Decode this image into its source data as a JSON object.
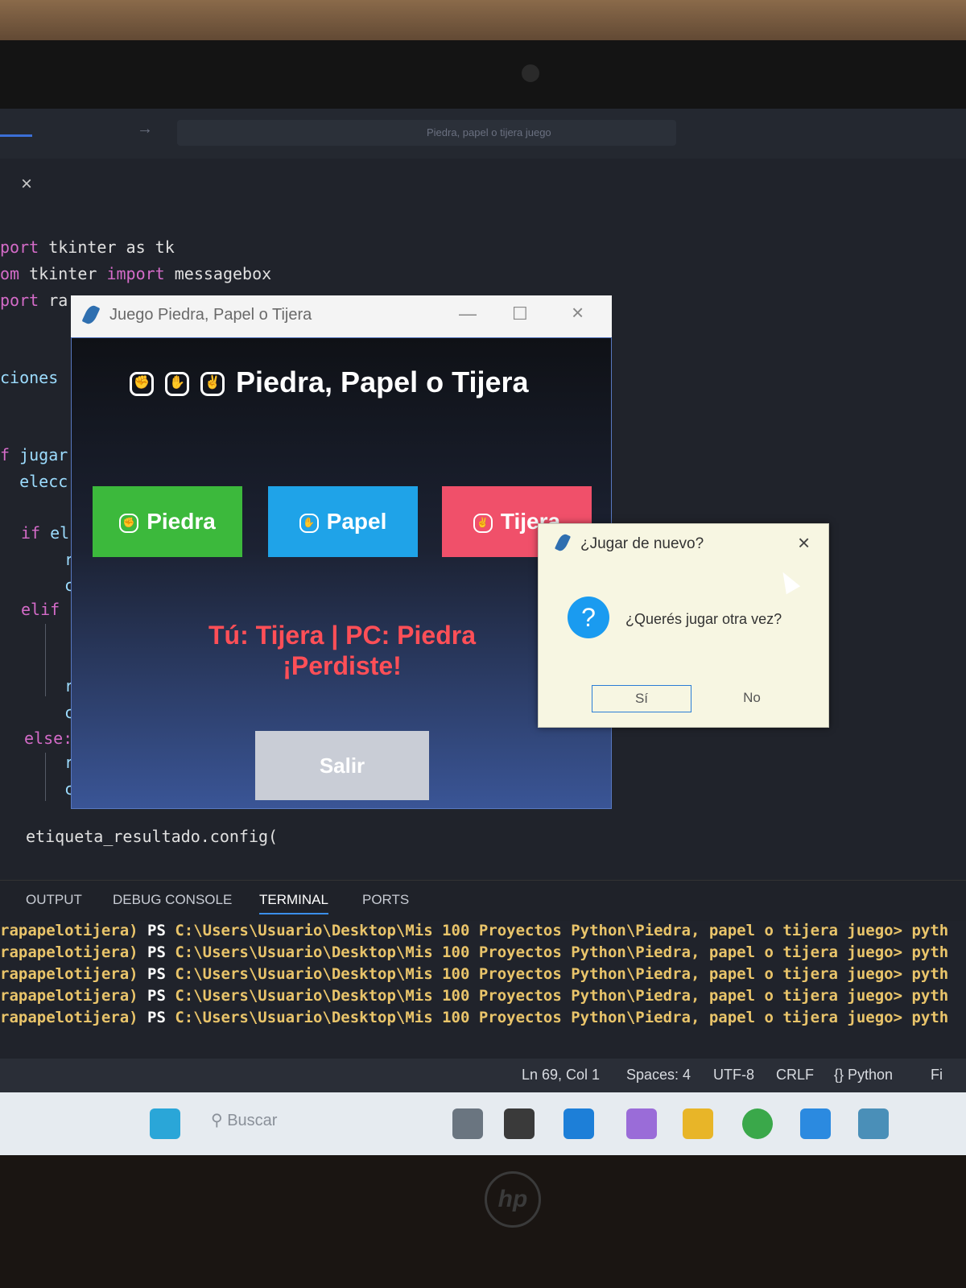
{
  "editor": {
    "search_placeholder": "Piedra, papel o tijera juego",
    "tab_close": "×",
    "code": {
      "l1_kw": "port",
      "l1_rest": " tkinter as tk",
      "l2_kw": "om",
      "l2_mid": " tkinter ",
      "l2_kw2": "import",
      "l2_rest": " messagebox",
      "l3_kw": "port",
      "l3_rest": " ra",
      "l4": "ciones",
      "l5_kw": "f",
      "l5_rest": " jugar",
      "l6": "  elecc",
      "l7_kw": "if",
      "l7_rest": " el",
      "l8": "r",
      "l9": "c",
      "l10_kw": "elif",
      "l11": "r",
      "l12": "c",
      "l13_kw": "else:",
      "l14": "r",
      "l15": "c",
      "l16": "etiqueta_resultado.config("
    }
  },
  "panel": {
    "tabs": [
      "OUTPUT",
      "DEBUG CONSOLE",
      "TERMINAL",
      "PORTS"
    ],
    "active_tab": "TERMINAL",
    "terminal_lines": [
      {
        "env": "rapapelotijera)",
        "ps": " PS ",
        "path": "C:\\Users\\Usuario\\Desktop\\Mis 100 Proyectos Python\\Piedra, papel o tijera juego>",
        "cmd": " pyth"
      },
      {
        "env": "rapapelotijera)",
        "ps": " PS ",
        "path": "C:\\Users\\Usuario\\Desktop\\Mis 100 Proyectos Python\\Piedra, papel o tijera juego>",
        "cmd": " pyth"
      },
      {
        "env": "rapapelotijera)",
        "ps": " PS ",
        "path": "C:\\Users\\Usuario\\Desktop\\Mis 100 Proyectos Python\\Piedra, papel o tijera juego>",
        "cmd": " pyth"
      },
      {
        "env": "rapapelotijera)",
        "ps": " PS ",
        "path": "C:\\Users\\Usuario\\Desktop\\Mis 100 Proyectos Python\\Piedra, papel o tijera juego>",
        "cmd": " pyth"
      },
      {
        "env": "rapapelotijera)",
        "ps": " PS ",
        "path": "C:\\Users\\Usuario\\Desktop\\Mis 100 Proyectos Python\\Piedra, papel o tijera juego>",
        "cmd": " pyth"
      }
    ]
  },
  "statusbar": {
    "position": "Ln 69, Col 1",
    "spaces": "Spaces: 4",
    "encoding": "UTF-8",
    "eol": "CRLF",
    "language": "{} Python",
    "extra": "Fi"
  },
  "taskbar": {
    "search_label": "Buscar"
  },
  "game_window": {
    "title": "Juego Piedra, Papel o Tijera",
    "heading": "Piedra, Papel o Tijera",
    "buttons": [
      {
        "label": "Piedra",
        "color": "#3cb93c"
      },
      {
        "label": "Papel",
        "color": "#1fa3e8"
      },
      {
        "label": "Tijera",
        "color": "#f0506a"
      }
    ],
    "result_line1": "Tú: Tijera | PC: Piedra",
    "result_line2": "¡Perdiste!",
    "exit_label": "Salir"
  },
  "dialog": {
    "title": "¿Jugar de nuevo?",
    "message": "¿Querés jugar otra vez?",
    "yes_label": "Sí",
    "no_label": "No",
    "close": "×",
    "question_mark": "?"
  },
  "colors": {
    "terminal_env": "#e9c46a",
    "result_text": "#ff4f57",
    "keyword": "#d46bc8"
  }
}
